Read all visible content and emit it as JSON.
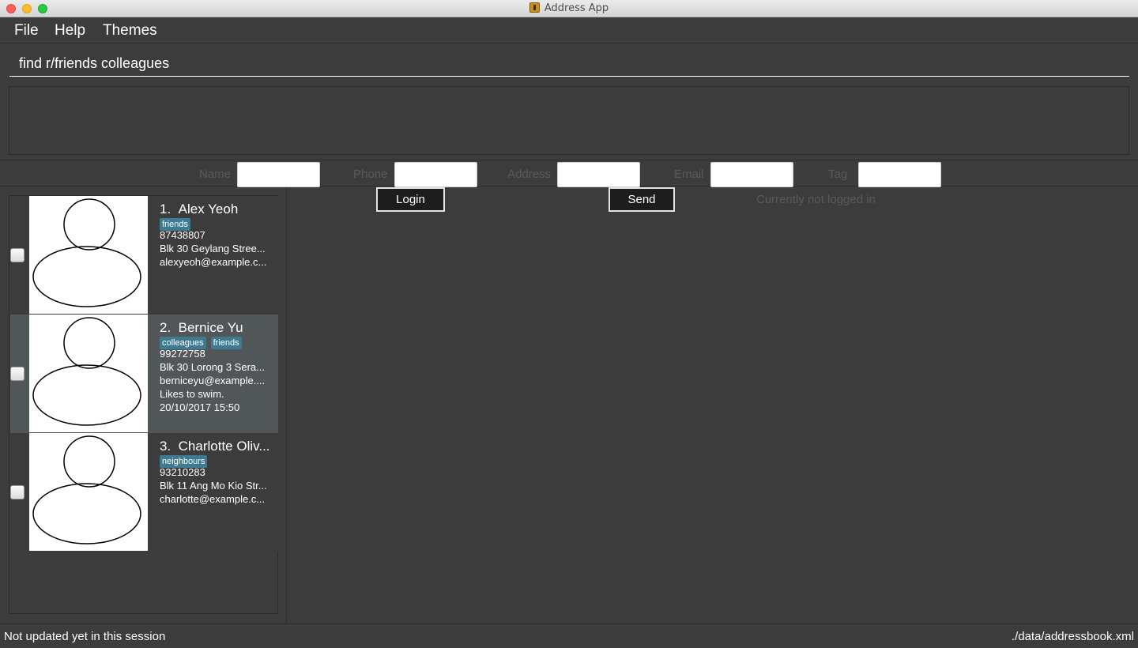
{
  "window": {
    "title": "Address App"
  },
  "menu": {
    "items": [
      "File",
      "Help",
      "Themes"
    ]
  },
  "command": {
    "value": "find r/friends colleagues"
  },
  "form": {
    "labels": {
      "name": "Name",
      "phone": "Phone",
      "address": "Address",
      "email": "Email",
      "tag": "Tag"
    },
    "login_label": "Login",
    "send_label": "Send",
    "login_status": "Currently not logged in"
  },
  "persons": [
    {
      "index": "1.",
      "name": "Alex Yeoh",
      "tags": [
        "friends"
      ],
      "phone": "87438807",
      "address": "Blk 30 Geylang Stree...",
      "email": "alexyeoh@example.c...",
      "remark": "",
      "date": ""
    },
    {
      "index": "2.",
      "name": "Bernice Yu",
      "tags": [
        "colleagues",
        "friends"
      ],
      "phone": "99272758",
      "address": "Blk 30 Lorong 3 Sera...",
      "email": "berniceyu@example....",
      "remark": "Likes to swim.",
      "date": "20/10/2017 15:50"
    },
    {
      "index": "3.",
      "name": "Charlotte Oliv...",
      "tags": [
        "neighbours"
      ],
      "phone": "93210283",
      "address": "Blk 11 Ang Mo Kio Str...",
      "email": "charlotte@example.c...",
      "remark": "",
      "date": ""
    }
  ],
  "status": {
    "sync": "Not updated yet in this session",
    "path": "./data/addressbook.xml"
  },
  "colors": {
    "background": "#3c3c3c",
    "selected_card": "#515658",
    "tag": "#3e7b91"
  }
}
